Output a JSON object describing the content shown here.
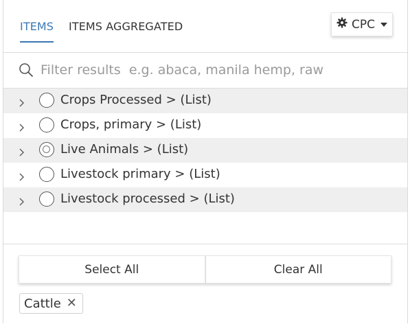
{
  "tabs": [
    {
      "label": "ITEMS",
      "active": true
    },
    {
      "label": "ITEMS AGGREGATED",
      "active": false
    }
  ],
  "classification_button": {
    "label": "CPC",
    "icon": "gear-icon"
  },
  "search": {
    "placeholder": "Filter results  e.g. abaca, manila hemp, raw",
    "value": ""
  },
  "rows": [
    {
      "label": "Crops Processed > (List)",
      "state": "unchecked"
    },
    {
      "label": "Crops, primary > (List)",
      "state": "unchecked"
    },
    {
      "label": "Live Animals > (List)",
      "state": "partial"
    },
    {
      "label": "Livestock primary > (List)",
      "state": "unchecked"
    },
    {
      "label": "Livestock processed > (List)",
      "state": "unchecked"
    }
  ],
  "actions": {
    "select_all": "Select All",
    "clear_all": "Clear All"
  },
  "selected": [
    {
      "label": "Cattle",
      "remove_icon": "close-icon"
    }
  ],
  "colors": {
    "accent": "#3b78b4",
    "row_shade": "#efefef"
  }
}
